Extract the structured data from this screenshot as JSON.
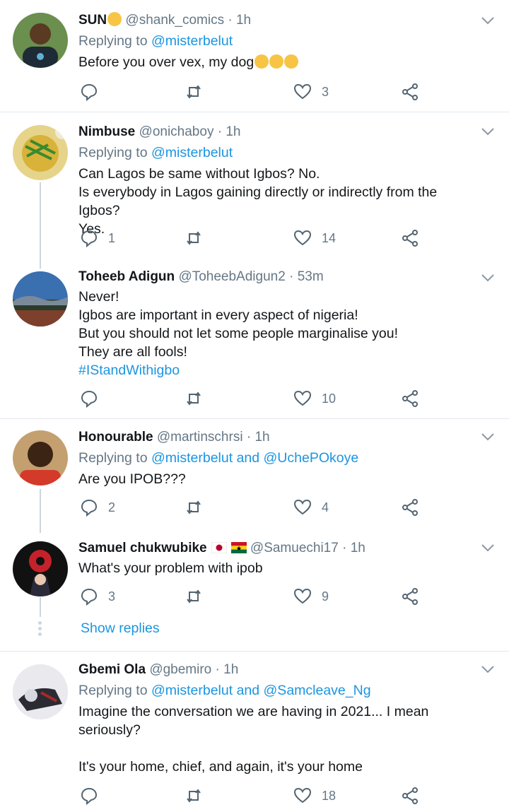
{
  "tweets": [
    {
      "name": "SUN",
      "handle": "@shank_comics",
      "time": "1h",
      "replying_label": "Replying to",
      "replying_to": "@misterbelut",
      "lines": [
        "Before you over vex, my dog"
      ],
      "replies": "",
      "retweets": "",
      "likes": "3",
      "avatar": "person-avatar"
    },
    {
      "name": "Nimbuse",
      "handle": "@onichaboy",
      "time": "1h",
      "replying_label": "Replying to",
      "replying_to": "@misterbelut",
      "lines": [
        "Can Lagos be same without Igbos? No.",
        "Is everybody in Lagos gaining directly or indirectly from the Igbos?",
        "Yes."
      ],
      "replies": "1",
      "retweets": "",
      "likes": "14",
      "avatar": "food-avatar"
    },
    {
      "name": "Toheeb Adigun",
      "handle": "@ToheebAdigun2",
      "time": "53m",
      "lines": [
        "Never!",
        "Igbos are important in every aspect of nigeria!",
        "But you should not let some people marginalise you!",
        "They are all fools!"
      ],
      "hashtag": "#IStandWithigbo",
      "replies": "",
      "retweets": "",
      "likes": "10",
      "avatar": "crowd-avatar"
    },
    {
      "name": "Honourable",
      "handle": "@martinschrsi",
      "time": "1h",
      "replying_label": "Replying to",
      "replying_to": "@misterbelut and @UchePOkoye",
      "lines": [
        "Are you IPOB???"
      ],
      "replies": "2",
      "retweets": "",
      "likes": "4",
      "avatar": "person-avatar"
    },
    {
      "name": "Samuel chukwubike",
      "handle": "@Samuechi17",
      "time": "1h",
      "lines": [
        "What's your problem with ipob"
      ],
      "replies": "3",
      "retweets": "",
      "likes": "9",
      "avatar": "anime-avatar",
      "show_replies": "Show replies"
    },
    {
      "name": "Gbemi Ola",
      "handle": "@gbemiro",
      "time": "1h",
      "replying_label": "Replying to",
      "replying_to": "@misterbelut and @Samcleave_Ng",
      "lines": [
        "Imagine the conversation we are having in 2021... I mean",
        "seriously?",
        "",
        "It's your home, chief, and again, it's your home"
      ],
      "replies": "",
      "retweets": "",
      "likes": "18",
      "avatar": "person-avatar"
    }
  ],
  "colors": {
    "link": "#1b95e0",
    "muted": "#657786",
    "divider": "#e1e8ed",
    "thread": "#ccd6dd"
  },
  "icons": [
    "reply-icon",
    "retweet-icon",
    "like-icon",
    "share-icon",
    "chevron-down-icon"
  ]
}
